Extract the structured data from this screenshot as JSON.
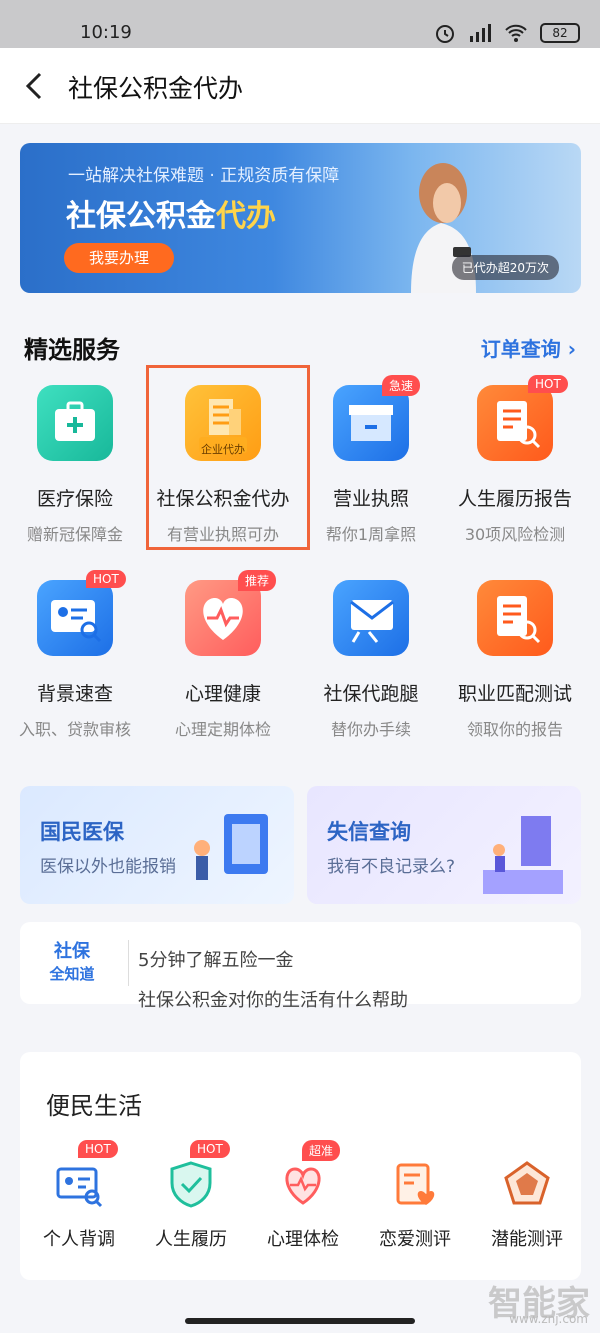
{
  "status_bar": {
    "time": "10:19",
    "battery": "82"
  },
  "header": {
    "title": "社保公积金代办"
  },
  "banner": {
    "subtitle": "一站解决社保难题 · 正规资质有保障",
    "title_main": "社保公积金",
    "title_highlight": "代办",
    "button": "我要办理",
    "badge": "已代办超20万次"
  },
  "selected_services": {
    "title": "精选服务",
    "order_link": "订单查询",
    "items": [
      {
        "name": "医疗保险",
        "desc": "赠新冠保障金",
        "icon": "medical-kit-icon",
        "tag": ""
      },
      {
        "name": "社保公积金代办",
        "desc": "有营业执照可办",
        "icon": "building-icon",
        "tag": "",
        "icon_label": "企业代办"
      },
      {
        "name": "营业执照",
        "desc": "帮你1周拿照",
        "icon": "store-icon",
        "tag": "急速"
      },
      {
        "name": "人生履历报告",
        "desc": "30项风险检测",
        "icon": "report-search-icon",
        "tag": "HOT"
      },
      {
        "name": "背景速查",
        "desc": "入职、贷款审核",
        "icon": "id-card-search-icon",
        "tag": "HOT"
      },
      {
        "name": "心理健康",
        "desc": "心理定期体检",
        "icon": "heart-pulse-icon",
        "tag": "推荐"
      },
      {
        "name": "社保代跑腿",
        "desc": "替你办手续",
        "icon": "mail-runner-icon",
        "tag": ""
      },
      {
        "name": "职业匹配测试",
        "desc": "领取你的报告",
        "icon": "document-search-icon",
        "tag": ""
      }
    ]
  },
  "promo_cards": [
    {
      "title": "国民医保",
      "subtitle": "医保以外也能报销"
    },
    {
      "title": "失信查询",
      "subtitle": "我有不良记录么?"
    }
  ],
  "knowledge": {
    "logo_line1": "社保",
    "logo_line2": "全知道",
    "line1": "5分钟了解五险一金",
    "line2": "社保公积金对你的生活有什么帮助"
  },
  "life": {
    "title": "便民生活",
    "items": [
      {
        "label": "个人背调",
        "tag": "HOT",
        "icon": "id-card-icon"
      },
      {
        "label": "人生履历",
        "tag": "HOT",
        "icon": "shield-check-icon"
      },
      {
        "label": "心理体检",
        "tag": "超准",
        "icon": "heart-icon"
      },
      {
        "label": "恋爱测评",
        "tag": "",
        "icon": "love-document-icon"
      },
      {
        "label": "潜能测评",
        "tag": "",
        "icon": "radar-icon"
      }
    ]
  },
  "watermark": {
    "text": "智能家",
    "url": "www.znj.com"
  },
  "colors": {
    "accent": "#2e73df",
    "hot": "#ff4e4e",
    "highlight": "#f0643a"
  }
}
